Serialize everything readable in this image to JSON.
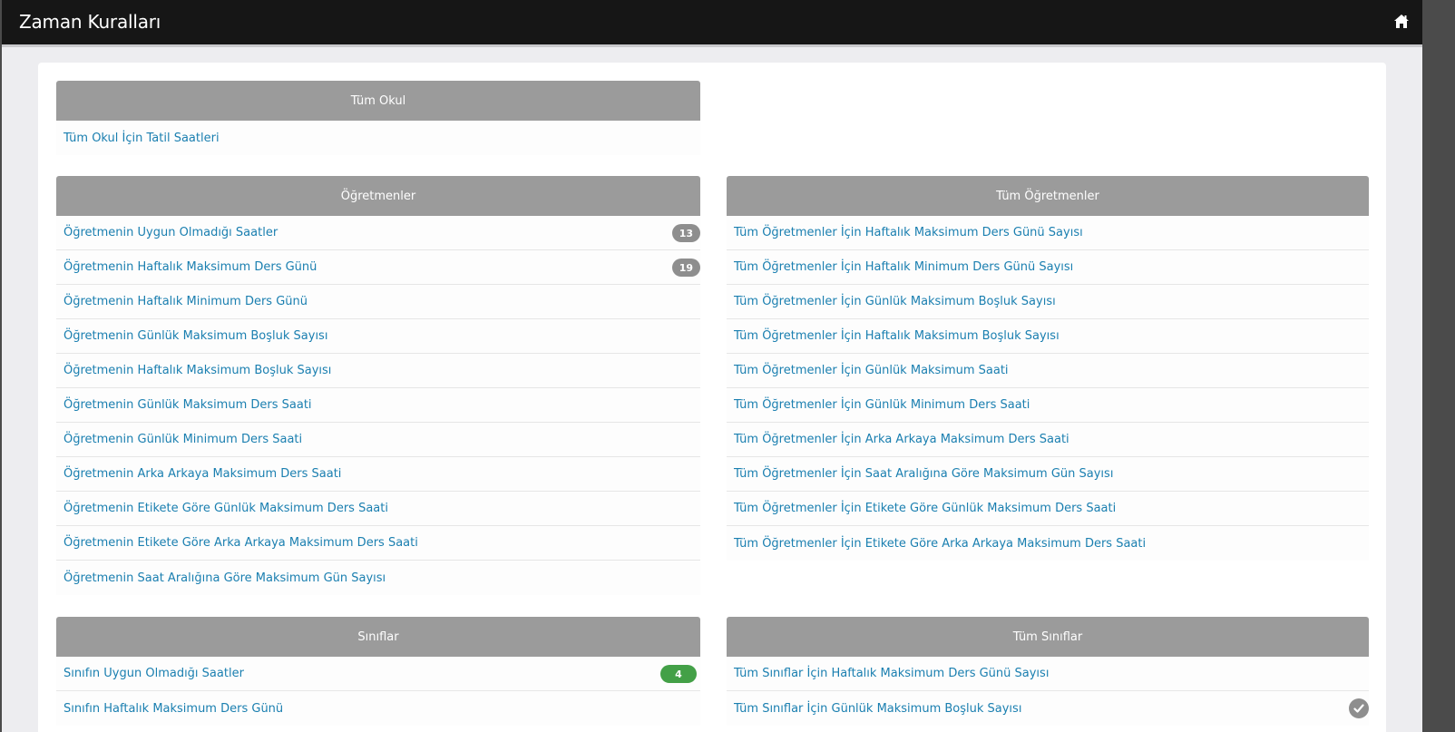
{
  "app": {
    "title": "Zaman Kuralları"
  },
  "tum_okul": {
    "header": "Tüm Okul",
    "items": [
      {
        "label": "Tüm Okul İçin Tatil Saatleri"
      }
    ]
  },
  "ogretmenler": {
    "header": "Öğretmenler",
    "items": [
      {
        "label": "Öğretmenin Uygun Olmadığı Saatler",
        "badge": "13"
      },
      {
        "label": "Öğretmenin Haftalık Maksimum Ders Günü",
        "badge": "19"
      },
      {
        "label": "Öğretmenin Haftalık Minimum Ders Günü"
      },
      {
        "label": "Öğretmenin Günlük Maksimum Boşluk Sayısı"
      },
      {
        "label": "Öğretmenin Haftalık Maksimum Boşluk Sayısı"
      },
      {
        "label": "Öğretmenin Günlük Maksimum Ders Saati"
      },
      {
        "label": "Öğretmenin Günlük Minimum Ders Saati"
      },
      {
        "label": "Öğretmenin Arka Arkaya Maksimum Ders Saati"
      },
      {
        "label": "Öğretmenin Etikete Göre Günlük Maksimum Ders Saati"
      },
      {
        "label": "Öğretmenin Etikete Göre Arka Arkaya Maksimum Ders Saati"
      },
      {
        "label": "Öğretmenin Saat Aralığına Göre Maksimum Gün Sayısı"
      }
    ]
  },
  "tum_ogretmenler": {
    "header": "Tüm Öğretmenler",
    "items": [
      {
        "label": "Tüm Öğretmenler İçin Haftalık Maksimum Ders Günü Sayısı"
      },
      {
        "label": "Tüm Öğretmenler İçin Haftalık Minimum Ders Günü Sayısı"
      },
      {
        "label": "Tüm Öğretmenler İçin Günlük Maksimum Boşluk Sayısı"
      },
      {
        "label": "Tüm Öğretmenler İçin Haftalık Maksimum Boşluk Sayısı"
      },
      {
        "label": "Tüm Öğretmenler İçin Günlük Maksimum Saati"
      },
      {
        "label": "Tüm Öğretmenler İçin Günlük Minimum Ders Saati"
      },
      {
        "label": "Tüm Öğretmenler İçin Arka Arkaya Maksimum Ders Saati"
      },
      {
        "label": "Tüm Öğretmenler İçin Saat Aralığına Göre Maksimum Gün Sayısı"
      },
      {
        "label": "Tüm Öğretmenler İçin Etikete Göre Günlük Maksimum Ders Saati"
      },
      {
        "label": "Tüm Öğretmenler İçin Etikete Göre Arka Arkaya Maksimum Ders Saati"
      }
    ]
  },
  "siniflar": {
    "header": "Sınıflar",
    "items": [
      {
        "label": "Sınıfın Uygun Olmadığı Saatler",
        "badge": "4"
      },
      {
        "label": "Sınıfın Haftalık Maksimum Ders Günü"
      }
    ]
  },
  "tum_siniflar": {
    "header": "Tüm Sınıflar",
    "items": [
      {
        "label": "Tüm Sınıflar İçin Haftalık Maksimum Ders Günü Sayısı"
      },
      {
        "label": "Tüm Sınıflar İçin Günlük Maksimum Boşluk Sayısı",
        "check": true
      }
    ]
  },
  "colors": {
    "link": "#1a7fb0",
    "header_bg": "#9b9b9b",
    "badge_gray": "#8e8e8e",
    "badge_green": "#43a047",
    "topbar": "#161616"
  },
  "icons": {
    "home": "home-icon",
    "check": "check-circle-icon"
  }
}
